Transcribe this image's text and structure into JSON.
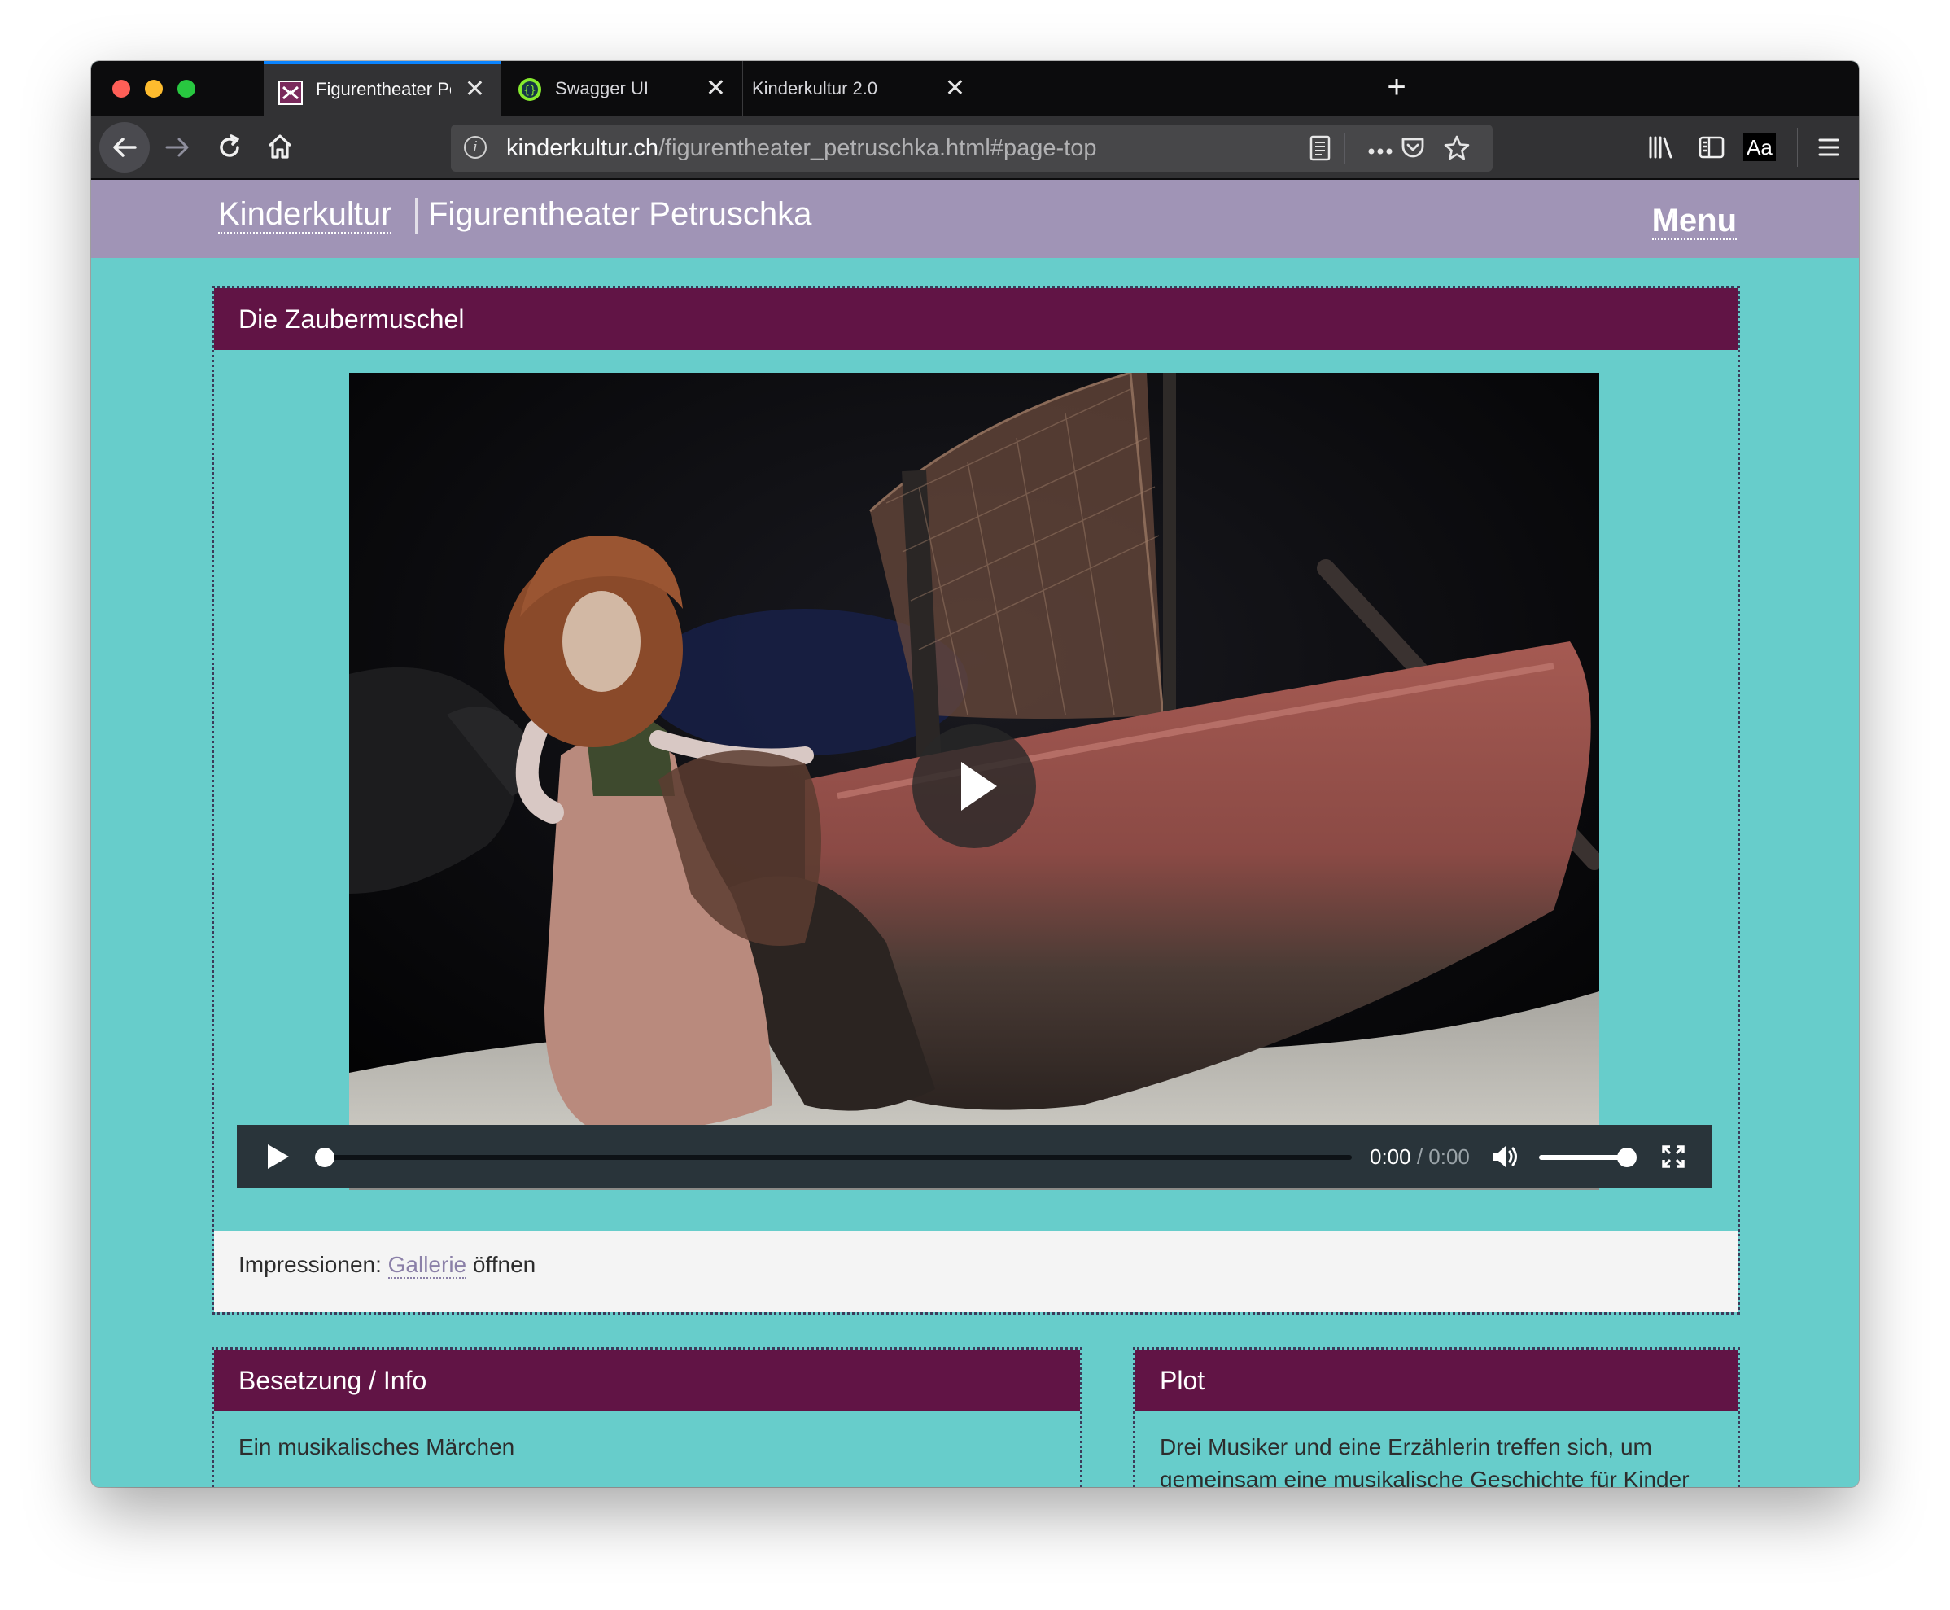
{
  "browser": {
    "tabs": [
      {
        "title": "Figurentheater Petruschka, Pav",
        "active": true,
        "close": "✕"
      },
      {
        "title": "Swagger UI",
        "active": false,
        "close": "✕"
      },
      {
        "title": "Kinderkultur 2.0",
        "active": false,
        "close": "✕"
      }
    ],
    "new_tab": "+",
    "url": {
      "host": "kinderkultur.ch",
      "path": "/figurentheater_petruschka.html#page-top"
    },
    "toolbar": {
      "reader_mode": "Aa"
    }
  },
  "site": {
    "brand": "Kinderkultur",
    "subtitle": "Figurentheater Petruschka",
    "menu": "Menu"
  },
  "video_panel": {
    "heading": "Die Zaubermuschel",
    "player": {
      "time_current": "0:00",
      "time_separator": " / ",
      "time_duration": "0:00",
      "progress": 0,
      "volume": 1.0
    },
    "caption": {
      "prefix": "Impressionen: ",
      "link": "Gallerie",
      "suffix": " öffnen"
    }
  },
  "info_panel": {
    "heading": "Besetzung / Info",
    "text": "Ein musikalisches Märchen"
  },
  "plot_panel": {
    "heading": "Plot",
    "text": "Drei Musiker und eine Erzählerin treffen sich, um gemeinsam eine musikalische Geschichte für Kinder"
  },
  "colors": {
    "header": "#a094b6",
    "page_bg": "#67cdcb",
    "panel_head": "#611445",
    "link": "#8b80a8"
  }
}
